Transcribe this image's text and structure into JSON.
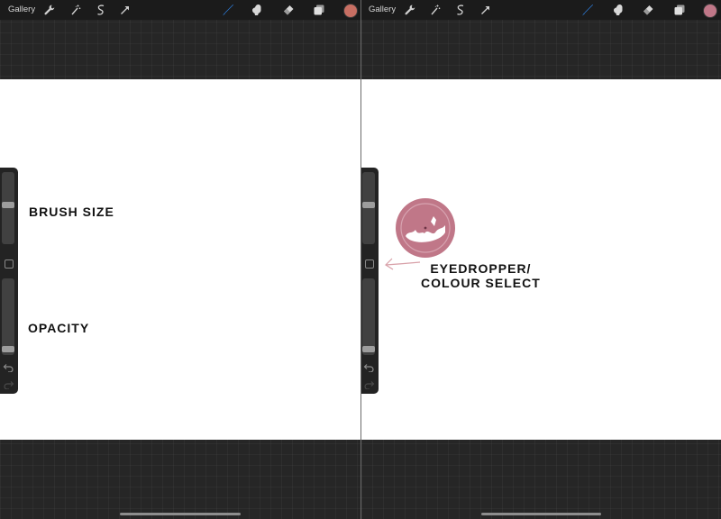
{
  "toolbar": {
    "gallery_label": "Gallery",
    "icons": [
      "wrench-icon",
      "magic-wand-icon",
      "selection-icon",
      "move-icon",
      "brush-icon",
      "smudge-icon",
      "eraser-icon",
      "layers-icon"
    ]
  },
  "colors": {
    "active_brush": "#2d7fe0",
    "current_color_left": "#c86f63",
    "current_color_right": "#c07788",
    "loupe_color": "#c07788",
    "canvas": "#ffffff",
    "annotation_text": "#111111",
    "arrow": "#d8a0a8"
  },
  "sidebar": {
    "brush_size_level": 0.55,
    "opacity_level": 0.04,
    "icons": [
      "modify-button",
      "undo-icon",
      "redo-icon"
    ]
  },
  "annotations": {
    "brush_size": "BRUSH SIZE",
    "opacity": "OPACITY",
    "eyedropper_line1": "EYEDROPPER/",
    "eyedropper_line2": "COLOUR SELECT"
  }
}
